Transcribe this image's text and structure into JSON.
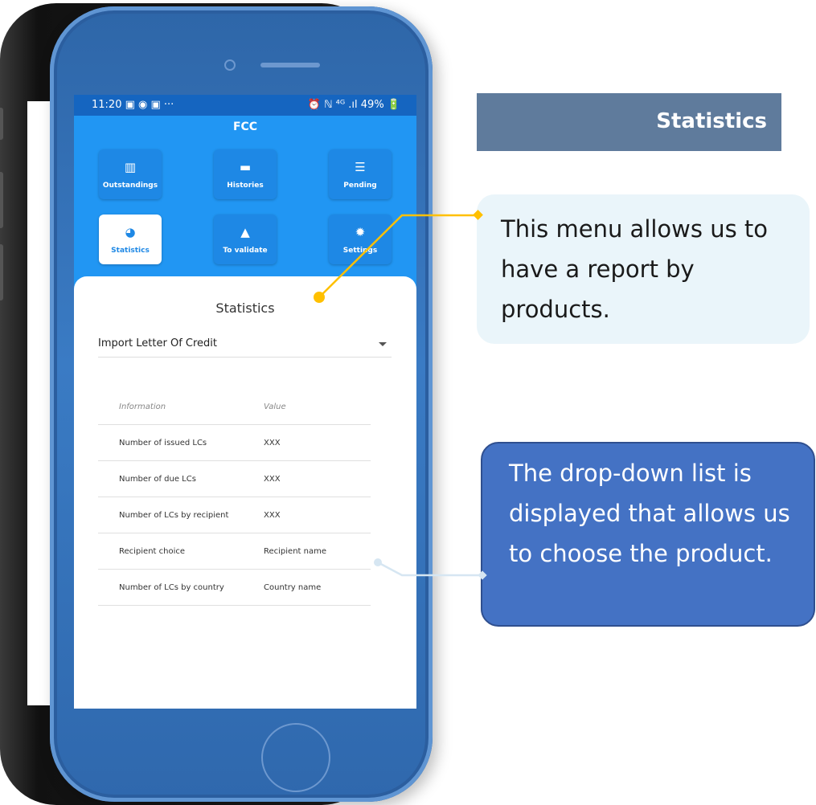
{
  "status_bar": {
    "time": "11:20 ▣ ◉ ▣ ···",
    "right": "⏰ ℕ ⁴ᴳ .ıl 49% 🔋"
  },
  "app": {
    "title": "FCC",
    "tiles": [
      {
        "label": "Outstandings",
        "icon": "bar-chart-icon",
        "glyph": "▥",
        "active": false
      },
      {
        "label": "Histories",
        "icon": "folder-icon",
        "glyph": "▬",
        "active": false
      },
      {
        "label": "Pending",
        "icon": "list-icon",
        "glyph": "☰",
        "active": false
      },
      {
        "label": "Statistics",
        "icon": "pie-chart-icon",
        "glyph": "◕",
        "active": true
      },
      {
        "label": "To validate",
        "icon": "warning-icon",
        "glyph": "▲",
        "active": false
      },
      {
        "label": "Settings",
        "icon": "gear-icon",
        "glyph": "✹",
        "active": false
      }
    ]
  },
  "panel": {
    "title": "Statistics",
    "dropdown_value": "Import Letter Of Credit",
    "table": {
      "headers": [
        "Information",
        "Value"
      ],
      "rows": [
        [
          "Number of issued LCs",
          "XXX"
        ],
        [
          "Number of due LCs",
          "XXX"
        ],
        [
          "Number of LCs by recipient",
          "XXX"
        ],
        [
          "Recipient choice",
          "Recipient name"
        ],
        [
          "Number of  LCs by country",
          "Country name"
        ]
      ]
    }
  },
  "callouts": {
    "header": "Statistics",
    "menu_note": "This menu allows us to have a report by products.",
    "dropdown_note": "The drop-down list is displayed  that allows us to choose the product."
  },
  "colors": {
    "accent_blue": "#2196f3",
    "connector_gold": "#ffc000",
    "callout_dark": "#4472c4",
    "header_bar": "#5f7b9c"
  }
}
